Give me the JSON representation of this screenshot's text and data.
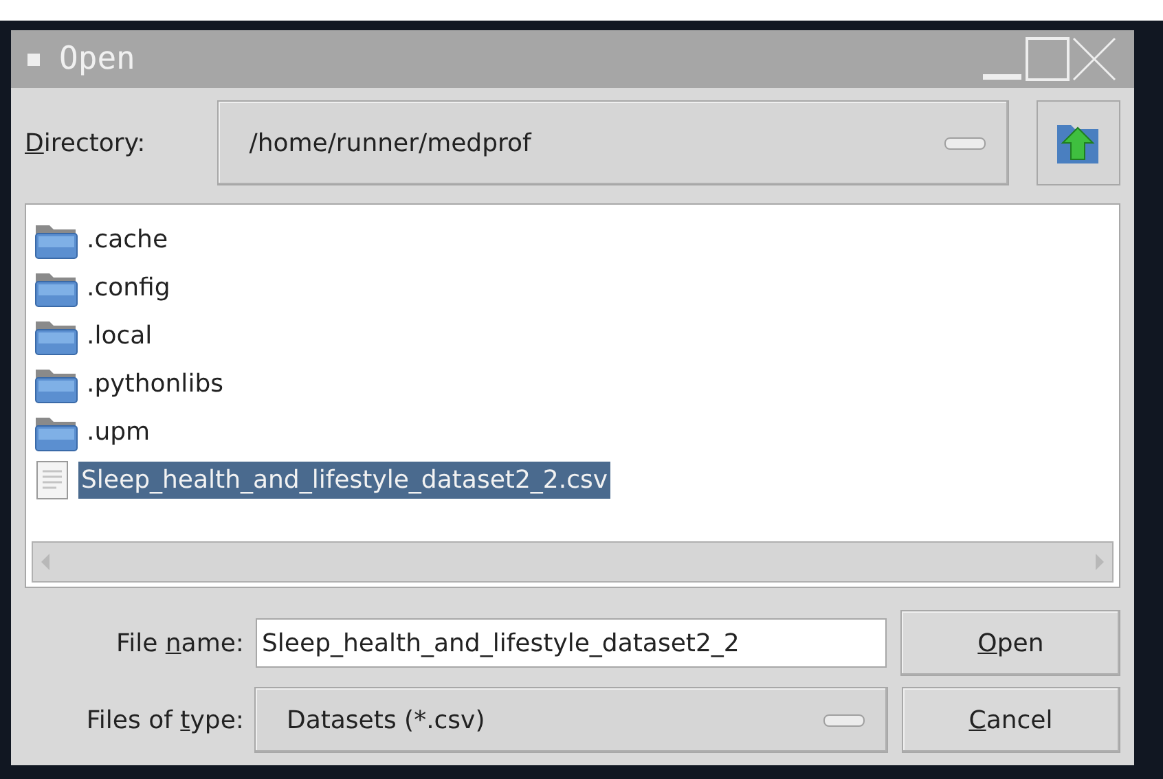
{
  "window": {
    "title": "Open"
  },
  "directory": {
    "label": {
      "key": "D",
      "post": "irectory:"
    },
    "value": "/home/runner/medprof"
  },
  "files": [
    {
      "name": ".cache",
      "kind": "folder",
      "selected": false
    },
    {
      "name": ".config",
      "kind": "folder",
      "selected": false
    },
    {
      "name": ".local",
      "kind": "folder",
      "selected": false
    },
    {
      "name": ".pythonlibs",
      "kind": "folder",
      "selected": false
    },
    {
      "name": ".upm",
      "kind": "folder",
      "selected": false
    },
    {
      "name": "Sleep_health_and_lifestyle_dataset2_2.csv",
      "kind": "file",
      "selected": true
    }
  ],
  "file_name": {
    "label": {
      "pre": "File ",
      "key": "n",
      "post": "ame:"
    },
    "value": "Sleep_health_and_lifestyle_dataset2_2"
  },
  "file_type": {
    "label": {
      "pre": "Files of ",
      "key": "t",
      "post": "ype:"
    },
    "value": "Datasets (*.csv)"
  },
  "buttons": [
    {
      "label": {
        "key": "O",
        "post": "pen"
      }
    },
    {
      "label": {
        "key": "C",
        "post": "ancel"
      }
    }
  ]
}
